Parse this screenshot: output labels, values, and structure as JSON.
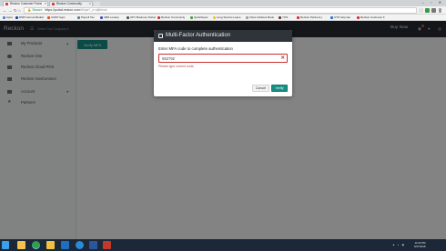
{
  "browser": {
    "tabs": [
      {
        "title": "Reckon Customer Portal",
        "active": true
      },
      {
        "title": "Reckon Community",
        "active": false
      }
    ],
    "window_controls": "–  ▫  ✕",
    "nav": {
      "back": "←",
      "forward": "→",
      "reload": "↻",
      "home": "⌂"
    },
    "address": {
      "secure_label": "🔒 Secure",
      "url_host": "https://portal.reckon.com",
      "url_path": "/#/ops?_z=ujkfmvw"
    },
    "bookmarks": [
      {
        "label": "Apps",
        "color": "#4f7fd1"
      },
      {
        "label": "DNB Internet Bankin",
        "color": "#1a4a8a"
      },
      {
        "label": "ACDP login",
        "color": "#e64a19"
      },
      {
        "label": "Payroll Tax",
        "color": "#607d8b"
      },
      {
        "label": "ABN Lookup",
        "color": "#3f51b5"
      },
      {
        "label": "ATO Business Portal",
        "color": "#455a64"
      },
      {
        "label": "Reckon Community",
        "color": "#d32f2f"
      },
      {
        "label": "QuickSuper",
        "color": "#43a047"
      },
      {
        "label": "Long Service Leave",
        "color": "#fbc02d"
      },
      {
        "label": "Vistor Address Book",
        "color": "#9e9e9e"
      },
      {
        "label": "YOS",
        "color": "#5d4037"
      },
      {
        "label": "Reckon Partners |",
        "color": "#d32f2f"
      },
      {
        "label": "CTP help site",
        "color": "#1976d2"
      },
      {
        "label": "Reckon Customer F",
        "color": "#d32f2f"
      }
    ]
  },
  "header": {
    "logo": "Reckon",
    "menu_icon": "☰",
    "org_select": "Select Your Company ▾",
    "buy_now": "Buy Now",
    "icons": [
      "bell-icon",
      "user-icon",
      "help-icon"
    ],
    "colors": {
      "bg": "#262b31",
      "accent": "#178f83"
    }
  },
  "sidebar": {
    "items": [
      {
        "label": "My Products",
        "icon": "grid-icon",
        "chevron": "▲"
      },
      {
        "label": "Reckon One",
        "icon": "cloud-icon"
      },
      {
        "label": "Reckon Cloud POS",
        "icon": "pos-icon"
      },
      {
        "label": "Reckon GovConnect",
        "icon": "govconnect-icon"
      },
      {
        "label": "Account",
        "icon": "account-icon",
        "chevron": "▼"
      },
      {
        "label": "Partners",
        "icon": "star-icon"
      }
    ]
  },
  "main": {
    "verify_mfa_button": "Verify MFA"
  },
  "modal": {
    "title": "Multi-Factor Authentication",
    "label": "Enter MFA code to complete authentication",
    "input_value": "052792",
    "clear_icon": "✕",
    "error": "Please type correct code.",
    "cancel": "Cancel",
    "verify": "Verify"
  },
  "taskbar": {
    "apps": [
      {
        "name": "start-icon",
        "color": "#3aa0e8"
      },
      {
        "name": "explorer-icon",
        "color": "#f2c14e"
      },
      {
        "name": "chrome-icon",
        "color": "#2e9e4f"
      },
      {
        "name": "folder-icon",
        "color": "#f0c040"
      },
      {
        "name": "outlook-icon",
        "color": "#1e6fc4"
      },
      {
        "name": "ie-icon",
        "color": "#2a8ad8"
      },
      {
        "name": "word-icon",
        "color": "#2b579a"
      },
      {
        "name": "reckon-icon",
        "color": "#c0392b"
      }
    ],
    "time": "12:22 PM",
    "date": "6/07/2018"
  }
}
